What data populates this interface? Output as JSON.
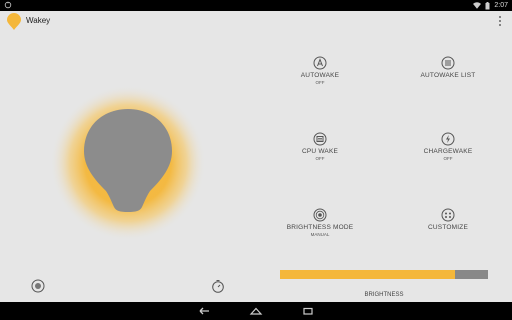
{
  "app": {
    "title": "Wakey"
  },
  "statusbar": {
    "time": "2:07"
  },
  "tiles": [
    {
      "label": "AUTOWAKE",
      "sub": "OFF",
      "icon": "autowake-icon"
    },
    {
      "label": "AUTOWAKE LIST",
      "sub": "",
      "icon": "list-icon"
    },
    {
      "label": "CPU WAKE",
      "sub": "OFF",
      "icon": "cpu-icon"
    },
    {
      "label": "CHARGEWAKE",
      "sub": "OFF",
      "icon": "charge-icon"
    },
    {
      "label": "BRIGHTNESS MODE",
      "sub": "MANUAL",
      "icon": "brightness-icon"
    },
    {
      "label": "CUSTOMIZE",
      "sub": "",
      "icon": "customize-icon"
    }
  ],
  "brightness": {
    "label": "BRIGHTNESS",
    "level": 0.84
  },
  "colors": {
    "accent": "#f4b73a",
    "bulb": "#8c8c8c",
    "background": "#e6e6e6"
  }
}
